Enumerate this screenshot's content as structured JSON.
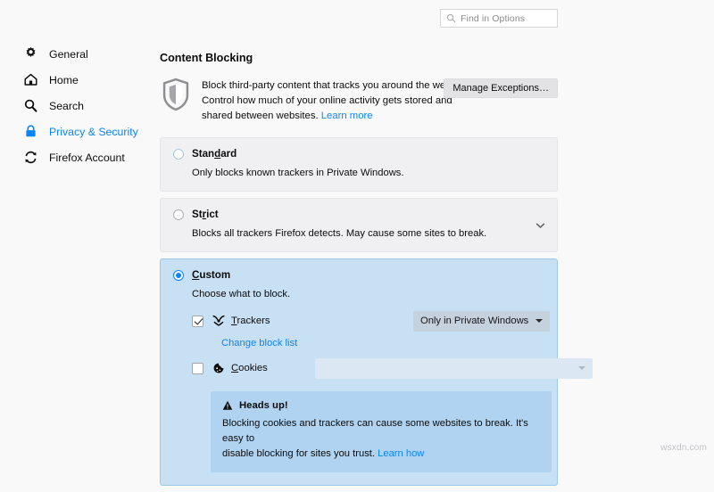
{
  "search": {
    "placeholder": "Find in Options",
    "icon": "search-icon"
  },
  "sidebar": {
    "items": [
      {
        "label": "General",
        "icon": "gear-icon",
        "active": false
      },
      {
        "label": "Home",
        "icon": "home-icon",
        "active": false
      },
      {
        "label": "Search",
        "icon": "search-icon",
        "active": false
      },
      {
        "label": "Privacy & Security",
        "icon": "lock-icon",
        "active": true
      },
      {
        "label": "Firefox Account",
        "icon": "sync-icon",
        "active": false
      }
    ],
    "active_color": "#0a84ff"
  },
  "main": {
    "section_title": "Content Blocking",
    "shield_icon": "shield-icon",
    "intro_line1": "Block third-party content that tracks you around the web.",
    "intro_line2": "Control how much of your online activity gets stored and",
    "intro_line3": "shared between websites.",
    "intro_learn_more": "Learn more",
    "manage_exceptions_label": "Manage Exceptions…",
    "options": [
      {
        "id": "standard",
        "name_prefix": "Stan",
        "name_accesskey": "d",
        "name_suffix": "ard",
        "description": "Only blocks known trackers in Private Windows.",
        "selected": false,
        "has_chevron": false
      },
      {
        "id": "strict",
        "name_prefix": "St",
        "name_accesskey": "r",
        "name_suffix": "ict",
        "description": "Blocks all trackers Firefox detects. May cause some sites to break.",
        "selected": false,
        "has_chevron": true,
        "chevron_icon": "chevron-down-icon"
      }
    ],
    "custom": {
      "name_prefix": "",
      "name_accesskey": "C",
      "name_suffix": "ustom",
      "selected": true,
      "description": "Choose what to block.",
      "trackers": {
        "label_prefix": "",
        "label_accesskey": "T",
        "label_suffix": "rackers",
        "icon": "tracker-icon",
        "checked": true,
        "dropdown_value": "Only in Private Windows",
        "dropdown_icon": "chevron-down-icon",
        "sublink": "Change block list"
      },
      "cookies": {
        "label_prefix": "",
        "label_accesskey": "C",
        "label_suffix": "ookies",
        "icon": "cookie-icon",
        "checked": false,
        "dropdown_value": "",
        "dropdown_icon": "chevron-down-icon",
        "disabled": true
      },
      "headsup": {
        "icon": "warning-triangle-icon",
        "title": "Heads up!",
        "line1": "Blocking cookies and trackers can cause some websites to break. It's easy to",
        "line2": "disable blocking for sites you trust.",
        "link": "Learn how"
      }
    }
  },
  "watermark": "wsxdn.com",
  "colors": {
    "page_background": "#f9f9fa",
    "panel_background": "#f0f0f2",
    "custom_panel_background": "#c8e0f4",
    "headsup_background": "#afd3f0",
    "link": "#0a84ff"
  }
}
